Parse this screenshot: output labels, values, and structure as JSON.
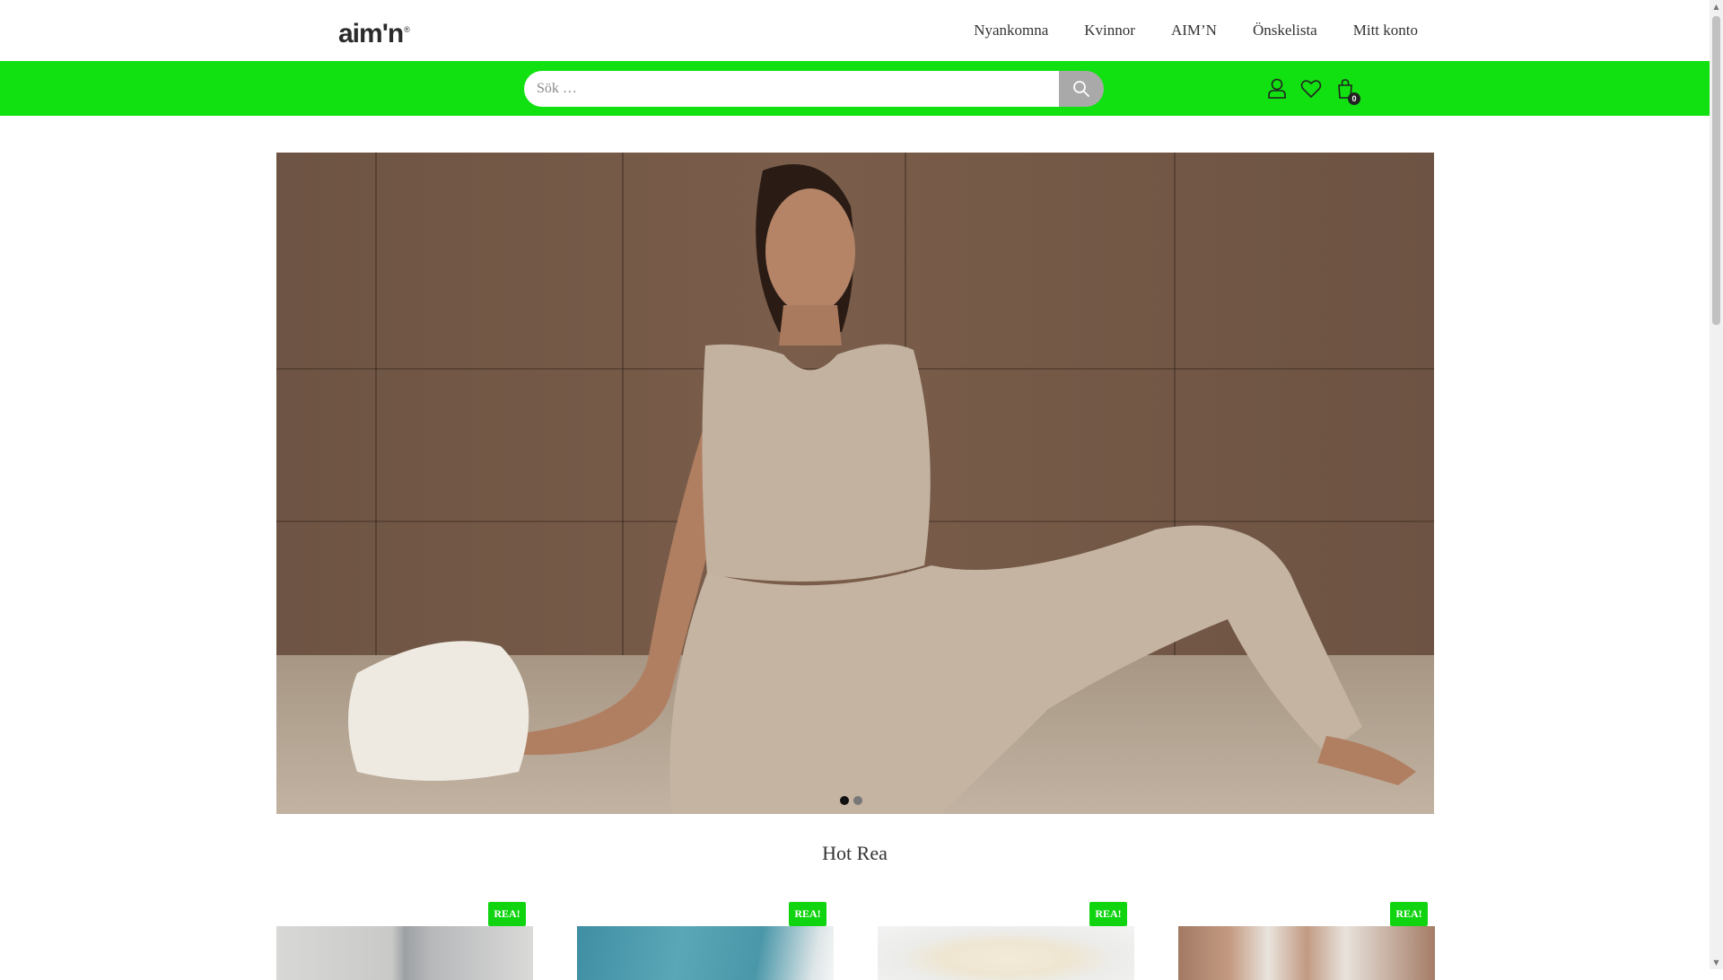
{
  "header": {
    "logo_text": "aim'n",
    "logo_mark": "®",
    "nav": [
      {
        "label": "Nyankomna"
      },
      {
        "label": "Kvinnor"
      },
      {
        "label": "AIM’N"
      },
      {
        "label": "Önskelista"
      },
      {
        "label": "Mitt konto"
      }
    ]
  },
  "searchbar": {
    "placeholder": "Sök …",
    "value": "",
    "cart_count": "0",
    "icons": [
      "user-icon",
      "heart-icon",
      "shopping-bag-icon",
      "search-icon"
    ]
  },
  "hero": {
    "slides": 2,
    "active_slide": 1
  },
  "section": {
    "title": "Hot Rea"
  },
  "products": [
    {
      "badge": "REA!"
    },
    {
      "badge": "REA!"
    },
    {
      "badge": "REA!"
    },
    {
      "badge": "REA!"
    }
  ],
  "colors": {
    "accent_green": "#11e011",
    "badge_green": "#11d411",
    "search_button": "#a9a9a9"
  }
}
